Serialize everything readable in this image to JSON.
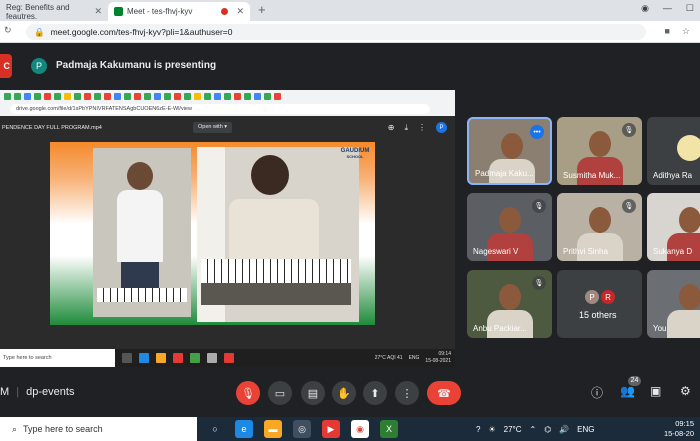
{
  "browser": {
    "tabs": [
      {
        "label": "Reg: Benefits and feautres."
      },
      {
        "label": "Meet - tes-fhvj-kyv"
      }
    ],
    "new_tab": "+",
    "address": "meet.google.com/tes-fhvj-kyv?pli=1&authuser=0"
  },
  "meet": {
    "presenter_initial": "P",
    "presenting_text": "Padmaja Kakumanu is presenting",
    "meeting_name": "dp-events",
    "meeting_prefix": "M",
    "participant_count": "24"
  },
  "shared_screen": {
    "drive_url": "drive.google.com/file/d/1sPbYPNIVRFATENSAgbCUOEN6zE-E-Wl/view",
    "file_name": "PENDENCE DAY FULL PROGRAM.mp4",
    "open_with": "Open with",
    "avatar_initial": "P",
    "logo_text": "GAUDIUM",
    "logo_sub": "SCHOOL",
    "taskbar_search": "Type here to search",
    "weather": "27°C  AQI 41",
    "lang": "ENG",
    "time": "09:14",
    "date": "15-08-2021"
  },
  "tiles": [
    {
      "name": "Padmaja Kaku...",
      "style": "photo",
      "bg": "#8a7f70"
    },
    {
      "name": "Susmitha Muk...",
      "style": "photo",
      "bg": "#a89e86"
    },
    {
      "name": "Adithya Ra",
      "style": "logo",
      "bg": "#3c4043"
    },
    {
      "name": "Nageswari V",
      "style": "photo",
      "bg": "#5b5f64"
    },
    {
      "name": "Prithvi Sinha",
      "style": "photo",
      "bg": "#b9b2a4"
    },
    {
      "name": "Sukanya D",
      "style": "photo",
      "bg": "#d8d4cf"
    },
    {
      "name": "Anbu Packiar...",
      "style": "photo",
      "bg": "#4e5a3f"
    },
    {
      "name": "15 others",
      "style": "others",
      "bg": "#3c4043",
      "initials": [
        "P",
        "R"
      ]
    },
    {
      "name": "You",
      "style": "photo",
      "bg": "#6b6f74"
    }
  ],
  "taskbar": {
    "search": "Type here to search",
    "temperature": "27°C",
    "lang": "ENG",
    "time": "09:15",
    "date": "15-08-20"
  },
  "colors": {
    "end_call": "#ea4335",
    "mic_off": "#ea4335",
    "bg": "#202124",
    "taskbar": "#1c2b3a"
  }
}
